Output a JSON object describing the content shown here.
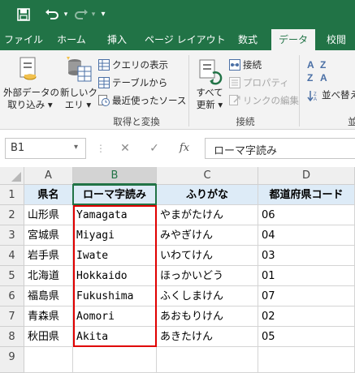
{
  "quick_access": {
    "save_icon": "save-icon",
    "undo_icon": "undo-icon",
    "redo_icon": "redo-icon",
    "customize_icon": "customize-icon"
  },
  "tabs": [
    {
      "label": "ファイル"
    },
    {
      "label": "ホーム"
    },
    {
      "label": "挿入"
    },
    {
      "label": "ページ レイアウト"
    },
    {
      "label": "数式"
    },
    {
      "label": "データ"
    },
    {
      "label": "校閲"
    }
  ],
  "ribbon": {
    "get_external_data": {
      "line1": "外部データの",
      "line2": "取り込み ▾"
    },
    "new_query": {
      "line1": "新しいク",
      "line2": "エリ ▾"
    },
    "show_queries": "クエリの表示",
    "from_table": "テーブルから",
    "recent_sources": "最近使ったソース",
    "group_get_transform": "取得と変換",
    "refresh_all": {
      "line1": "すべて",
      "line2": "更新 ▾"
    },
    "connections": "接続",
    "properties": "プロパティ",
    "edit_links": "リンクの編集",
    "group_connections": "接続",
    "sort": "並べ替え",
    "group_partial": "並"
  },
  "formula_bar": {
    "name_box": "B1",
    "cancel": "✕",
    "enter": "✓",
    "fx": "fx",
    "content": "ローマ字読み"
  },
  "grid": {
    "columns": [
      "A",
      "B",
      "C",
      "D"
    ],
    "header_row": [
      "県名",
      "ローマ字読み",
      "ふりがな",
      "都道府県コード"
    ],
    "rows": [
      {
        "num": "1"
      },
      {
        "num": "2",
        "a": "山形県",
        "b": "Yamagata",
        "c": "やまがたけん",
        "d": "06"
      },
      {
        "num": "3",
        "a": "宮城県",
        "b": "Miyagi",
        "c": "みやぎけん",
        "d": "04"
      },
      {
        "num": "4",
        "a": "岩手県",
        "b": "Iwate",
        "c": "いわてけん",
        "d": "03"
      },
      {
        "num": "5",
        "a": "北海道",
        "b": "Hokkaido",
        "c": "ほっかいどう",
        "d": "01"
      },
      {
        "num": "6",
        "a": "福島県",
        "b": "Fukushima",
        "c": "ふくしまけん",
        "d": "07"
      },
      {
        "num": "7",
        "a": "青森県",
        "b": "Aomori",
        "c": "あおもりけん",
        "d": "02"
      },
      {
        "num": "8",
        "a": "秋田県",
        "b": "Akita",
        "c": "あきたけん",
        "d": "05"
      },
      {
        "num": "9"
      }
    ]
  },
  "colors": {
    "excel_green": "#217346",
    "header_fill": "#ddebf7",
    "highlight_border": "#e00000"
  }
}
